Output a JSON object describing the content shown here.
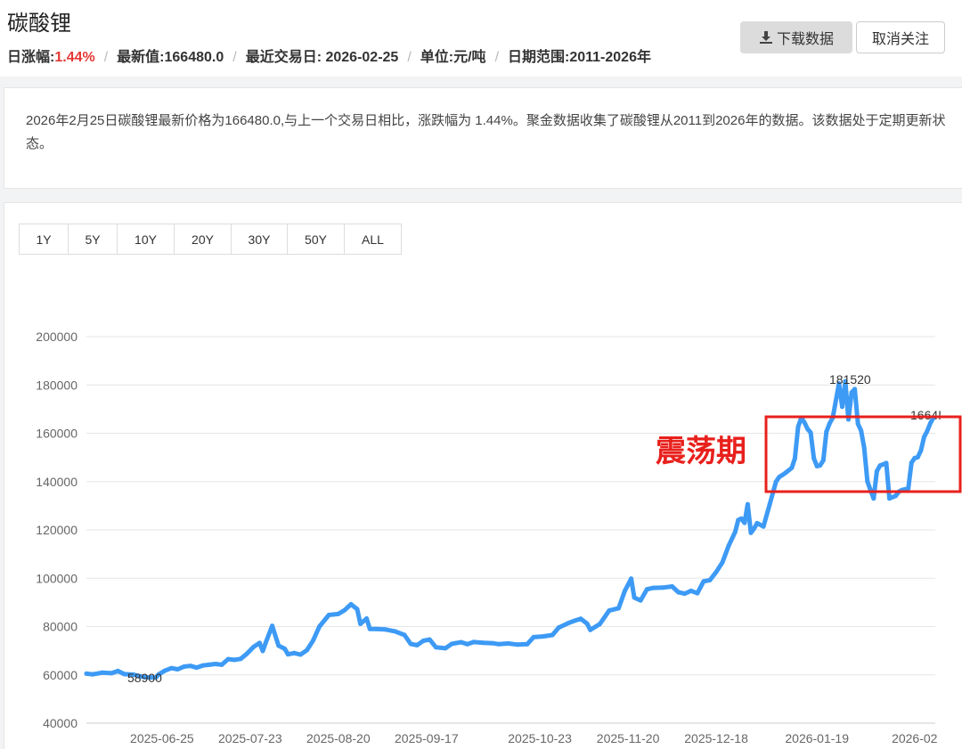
{
  "header": {
    "title": "碳酸锂",
    "change_label": "日涨幅:",
    "change_value": "1.44%",
    "latest": "最新值:166480.0",
    "last_trade": "最近交易日: 2026-02-25",
    "unit": "单位:元/吨",
    "range": "日期范围:2011-2026年",
    "separator": "/",
    "download_label": "下载数据",
    "unfollow_label": "取消关注",
    "download_icon": "download-icon"
  },
  "description": "2026年2月25日碳酸锂最新价格为166480.0,与上一个交易日相比，涨跌幅为 1.44%。聚金数据收集了碳酸锂从2011到2026年的数据。该数据处于定期更新状态。",
  "range_buttons": [
    "1Y",
    "5Y",
    "10Y",
    "20Y",
    "30Y",
    "50Y",
    "ALL"
  ],
  "colors": {
    "line": "#3d9af5",
    "up": "#e53935",
    "annotation": "#e8201c"
  },
  "chart_data": {
    "type": "line",
    "x_ticks": [
      "2025-06-25",
      "2025-07-23",
      "2025-08-20",
      "2025-09-17",
      "2025-10-23",
      "2025-11-20",
      "2025-12-18",
      "2026-01-19",
      "2026-02"
    ],
    "y_ticks": [
      "200000",
      "180000",
      "160000",
      "140000",
      "120000",
      "100000",
      "80000",
      "60000",
      "40000"
    ],
    "ylim": [
      40000,
      200000
    ],
    "x_range": [
      "2025-06-01",
      "2026-02-25"
    ],
    "grid": true,
    "annotations": {
      "min_label": "58900",
      "max_label": "181520",
      "last_label": "1664!",
      "box_label": "震荡期"
    },
    "series": [
      {
        "points": [
          [
            "2025-06-01",
            60500
          ],
          [
            "2025-06-03",
            60200
          ],
          [
            "2025-06-06",
            60900
          ],
          [
            "2025-06-09",
            60700
          ],
          [
            "2025-06-11",
            61600
          ],
          [
            "2025-06-13",
            60300
          ],
          [
            "2025-06-16",
            60100
          ],
          [
            "2025-06-18",
            59400
          ],
          [
            "2025-06-20",
            59000
          ],
          [
            "2025-06-23",
            58900
          ],
          [
            "2025-06-24",
            60200
          ],
          [
            "2025-06-26",
            61800
          ],
          [
            "2025-06-28",
            62800
          ],
          [
            "2025-06-30",
            62300
          ],
          [
            "2025-07-02",
            63400
          ],
          [
            "2025-07-04",
            63700
          ],
          [
            "2025-07-06",
            63000
          ],
          [
            "2025-07-08",
            63900
          ],
          [
            "2025-07-10",
            64200
          ],
          [
            "2025-07-12",
            64500
          ],
          [
            "2025-07-14",
            64200
          ],
          [
            "2025-07-16",
            66500
          ],
          [
            "2025-07-18",
            66200
          ],
          [
            "2025-07-20",
            66600
          ],
          [
            "2025-07-22",
            68800
          ],
          [
            "2025-07-24",
            71500
          ],
          [
            "2025-07-26",
            73200
          ],
          [
            "2025-07-27",
            69900
          ],
          [
            "2025-07-28",
            73500
          ],
          [
            "2025-07-30",
            80300
          ],
          [
            "2025-08-01",
            72100
          ],
          [
            "2025-08-03",
            70800
          ],
          [
            "2025-08-04",
            68500
          ],
          [
            "2025-08-06",
            69000
          ],
          [
            "2025-08-08",
            68400
          ],
          [
            "2025-08-10",
            70200
          ],
          [
            "2025-08-12",
            74200
          ],
          [
            "2025-08-14",
            80000
          ],
          [
            "2025-08-17",
            84800
          ],
          [
            "2025-08-20",
            85200
          ],
          [
            "2025-08-22",
            86800
          ],
          [
            "2025-08-24",
            89200
          ],
          [
            "2025-08-26",
            87200
          ],
          [
            "2025-08-27",
            81100
          ],
          [
            "2025-08-29",
            83300
          ],
          [
            "2025-08-30",
            79000
          ],
          [
            "2025-09-01",
            79000
          ],
          [
            "2025-09-04",
            78800
          ],
          [
            "2025-09-07",
            78000
          ],
          [
            "2025-09-10",
            76500
          ],
          [
            "2025-09-12",
            72800
          ],
          [
            "2025-09-14",
            72300
          ],
          [
            "2025-09-16",
            74100
          ],
          [
            "2025-09-18",
            74600
          ],
          [
            "2025-09-20",
            71400
          ],
          [
            "2025-09-23",
            71000
          ],
          [
            "2025-09-25",
            72800
          ],
          [
            "2025-09-28",
            73500
          ],
          [
            "2025-09-30",
            72700
          ],
          [
            "2025-10-02",
            73600
          ],
          [
            "2025-10-05",
            73300
          ],
          [
            "2025-10-08",
            73100
          ],
          [
            "2025-10-10",
            72700
          ],
          [
            "2025-10-13",
            73000
          ],
          [
            "2025-10-16",
            72500
          ],
          [
            "2025-10-19",
            72700
          ],
          [
            "2025-10-21",
            75600
          ],
          [
            "2025-10-24",
            75900
          ],
          [
            "2025-10-27",
            76500
          ],
          [
            "2025-10-29",
            79600
          ],
          [
            "2025-11-01",
            81400
          ],
          [
            "2025-11-03",
            82400
          ],
          [
            "2025-11-05",
            83200
          ],
          [
            "2025-11-07",
            81200
          ],
          [
            "2025-11-08",
            78600
          ],
          [
            "2025-11-11",
            81000
          ],
          [
            "2025-11-14",
            86600
          ],
          [
            "2025-11-17",
            87600
          ],
          [
            "2025-11-19",
            94800
          ],
          [
            "2025-11-21",
            99800
          ],
          [
            "2025-11-22",
            92000
          ],
          [
            "2025-11-24",
            90800
          ],
          [
            "2025-11-26",
            95400
          ],
          [
            "2025-11-28",
            96000
          ],
          [
            "2025-12-01",
            96100
          ],
          [
            "2025-12-04",
            96600
          ],
          [
            "2025-12-06",
            94200
          ],
          [
            "2025-12-08",
            93600
          ],
          [
            "2025-12-10",
            94800
          ],
          [
            "2025-12-12",
            93800
          ],
          [
            "2025-12-14",
            98700
          ],
          [
            "2025-12-16",
            99200
          ],
          [
            "2025-12-18",
            102600
          ],
          [
            "2025-12-20",
            106600
          ],
          [
            "2025-12-22",
            113600
          ],
          [
            "2025-12-24",
            119100
          ],
          [
            "2025-12-25",
            124100
          ],
          [
            "2025-12-26",
            124700
          ],
          [
            "2025-12-27",
            122900
          ],
          [
            "2025-12-28",
            130600
          ],
          [
            "2025-12-29",
            118800
          ],
          [
            "2025-12-30",
            120500
          ],
          [
            "2025-12-31",
            122800
          ],
          [
            "2026-01-02",
            121400
          ],
          [
            "2026-01-04",
            130700
          ],
          [
            "2026-01-06",
            140000
          ],
          [
            "2026-01-07",
            141900
          ],
          [
            "2026-01-08",
            142700
          ],
          [
            "2026-01-09",
            143600
          ],
          [
            "2026-01-11",
            145700
          ],
          [
            "2026-01-12",
            149600
          ],
          [
            "2026-01-13",
            162600
          ],
          [
            "2026-01-14",
            166400
          ],
          [
            "2026-01-15",
            164500
          ],
          [
            "2026-01-16",
            161800
          ],
          [
            "2026-01-17",
            160300
          ],
          [
            "2026-01-18",
            149600
          ],
          [
            "2026-01-19",
            146400
          ],
          [
            "2026-01-20",
            146700
          ],
          [
            "2026-01-21",
            148800
          ],
          [
            "2026-01-22",
            160700
          ],
          [
            "2026-01-23",
            164000
          ],
          [
            "2026-01-24",
            166400
          ],
          [
            "2026-01-26",
            180600
          ],
          [
            "2026-01-27",
            171000
          ],
          [
            "2026-01-28",
            181520
          ],
          [
            "2026-01-29",
            165700
          ],
          [
            "2026-01-30",
            176900
          ],
          [
            "2026-01-31",
            178300
          ],
          [
            "2026-02-01",
            163900
          ],
          [
            "2026-02-02",
            161100
          ],
          [
            "2026-02-03",
            154000
          ],
          [
            "2026-02-04",
            140100
          ],
          [
            "2026-02-05",
            136400
          ],
          [
            "2026-02-06",
            133000
          ],
          [
            "2026-02-07",
            144300
          ],
          [
            "2026-02-08",
            146600
          ],
          [
            "2026-02-10",
            147700
          ],
          [
            "2026-02-11",
            133000
          ],
          [
            "2026-02-13",
            134100
          ],
          [
            "2026-02-14",
            135800
          ],
          [
            "2026-02-15",
            136500
          ],
          [
            "2026-02-17",
            137100
          ],
          [
            "2026-02-18",
            147800
          ],
          [
            "2026-02-19",
            149700
          ],
          [
            "2026-02-20",
            150100
          ],
          [
            "2026-02-21",
            152900
          ],
          [
            "2026-02-22",
            158400
          ],
          [
            "2026-02-23",
            160900
          ],
          [
            "2026-02-24",
            164200
          ],
          [
            "2026-02-25",
            166480
          ]
        ]
      }
    ]
  }
}
